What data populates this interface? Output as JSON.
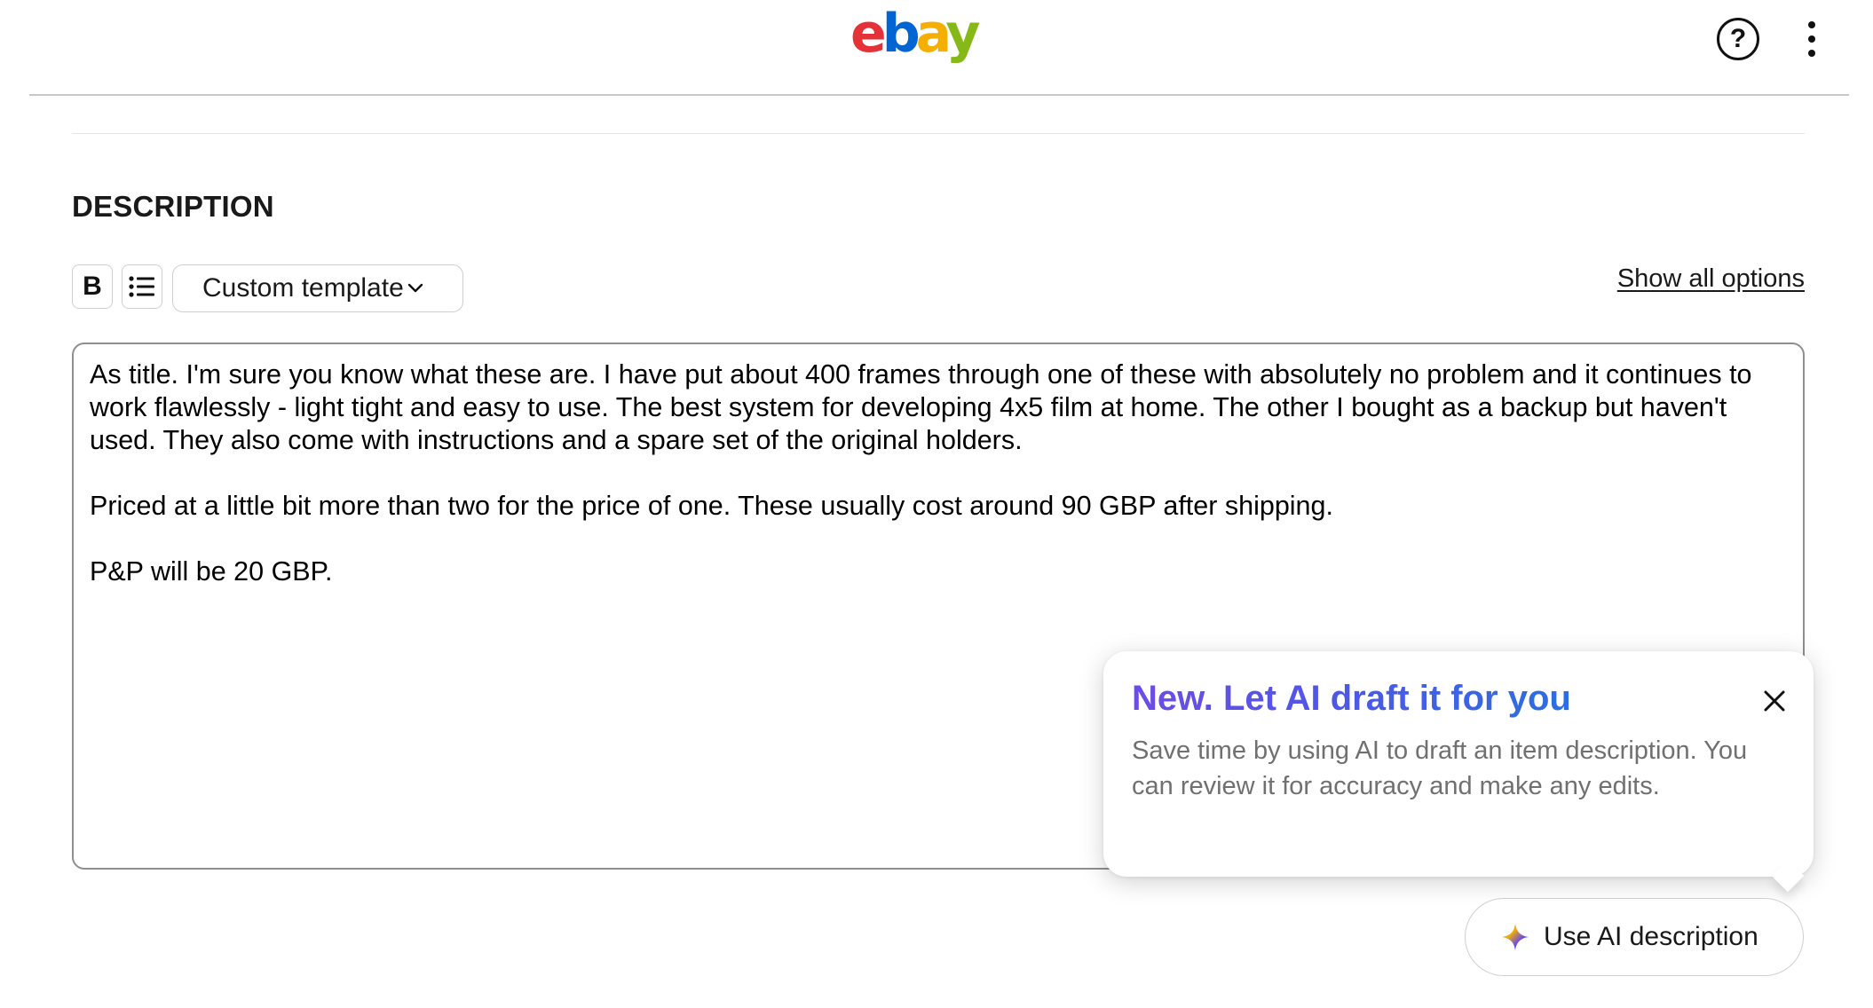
{
  "header": {
    "logo": {
      "letters": [
        "e",
        "b",
        "a",
        "y"
      ],
      "colors": [
        "#e53238",
        "#0064d2",
        "#f5af02",
        "#86b817"
      ]
    },
    "help_icon": "question-circle-icon",
    "help_glyph": "?",
    "menu_icon": "kebab-menu-icon"
  },
  "description": {
    "title": "DESCRIPTION",
    "toolbar": {
      "bold_label": "B",
      "list_icon": "bulleted-list-icon",
      "template_label": "Custom template",
      "template_icon": "chevron-down-icon"
    },
    "show_all_options": "Show all options",
    "paragraphs": [
      "As title. I'm sure you know what these are. I have put about 400 frames through one of these with absolutely no problem and it continues to work flawlessly - light tight and easy to use. The best system for developing 4x5 film at home. The other I bought as a backup but haven't used. They also come with instructions and a spare set of the original holders.",
      "Priced at a little bit more than two for the price of one. These usually cost around 90 GBP after shipping.",
      "P&P will be 20 GBP."
    ]
  },
  "ai_popover": {
    "title": "New. Let AI draft it for you",
    "body": "Save time by using AI to draft an item description. You can review it for accuracy and make any edits.",
    "close_icon": "close-icon",
    "gradient_colors": [
      "#6c4ce6",
      "#4f57e8",
      "#2b6fe0"
    ]
  },
  "use_ai_button": {
    "label": "Use AI description",
    "icon": "ai-sparkle-icon"
  }
}
